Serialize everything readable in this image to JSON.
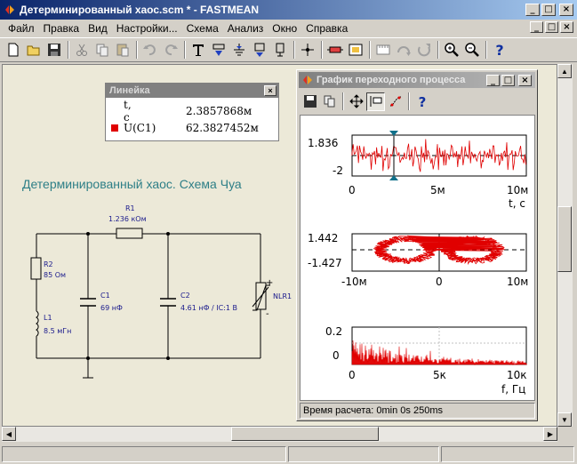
{
  "window": {
    "title": "Детерминированный хаос.scm * - FASTMEAN",
    "minimize": "_",
    "maximize": "□",
    "close": "×"
  },
  "menu": [
    {
      "label": "Файл"
    },
    {
      "label": "Правка"
    },
    {
      "label": "Вид"
    },
    {
      "label": "Настройки..."
    },
    {
      "label": "Схема"
    },
    {
      "label": "Анализ"
    },
    {
      "label": "Окно"
    },
    {
      "label": "Справка"
    }
  ],
  "toolbar": {
    "icons": [
      "new-document-icon",
      "open-folder-icon",
      "save-icon",
      "cut-icon",
      "copy-icon",
      "paste-icon",
      "undo-icon",
      "redo-icon",
      "text-tool-icon",
      "label-down-icon",
      "ground-icon",
      "component-icon",
      "port-icon",
      "node-icon",
      "resistor-icon",
      "element-icon",
      "measure-icon",
      "flip-icon",
      "rotate-icon",
      "zoom-in-icon",
      "zoom-out-icon",
      "help-icon"
    ]
  },
  "schematic": {
    "title": "Детерминированный хаос. Схема Чуа",
    "R1": {
      "name": "R1",
      "value": "1.236 кОм"
    },
    "R2": {
      "name": "R2",
      "value": "85 Ом"
    },
    "L1": {
      "name": "L1",
      "value": "8.5 мГн"
    },
    "C1": {
      "name": "C1",
      "value": "69 нФ"
    },
    "C2": {
      "name": "C2",
      "value": "4.61 нФ / IC:1 В"
    },
    "NLR1": {
      "name": "NLR1",
      "plus": "+",
      "minus": "-"
    }
  },
  "ruler": {
    "title": "Линейка",
    "close": "×",
    "rows": [
      {
        "label": "t, с",
        "value": "2.3857868м"
      },
      {
        "label": "U(C1)",
        "value": "62.3827452м"
      }
    ],
    "trace_color": "#e00000"
  },
  "graph": {
    "title": "График переходного процесса",
    "status": "Время расчета: 0min 0s 250ms",
    "trace_color": "#e00000",
    "plot1": {
      "ymax": "1.836",
      "ymin": "-2",
      "x0": "0",
      "x1": "5м",
      "x2": "10м",
      "xlabel": "t, c"
    },
    "plot2": {
      "ymax": "1.442",
      "ymin": "-1.427",
      "x0": "-10м",
      "x1": "0",
      "x2": "10м"
    },
    "plot3": {
      "ymax": "0.2",
      "ymin": "0",
      "x0": "0",
      "x1": "5к",
      "x2": "10к",
      "xlabel": "f, Гц"
    }
  }
}
